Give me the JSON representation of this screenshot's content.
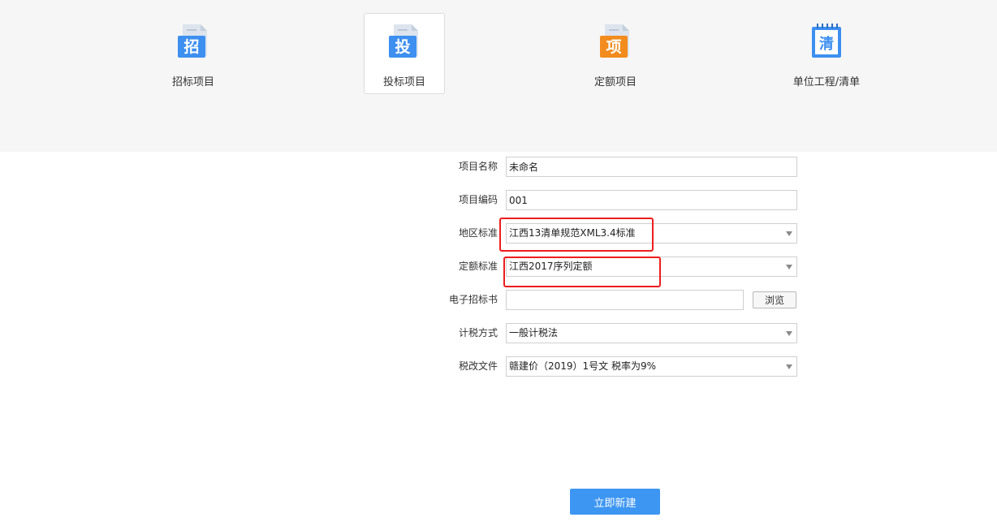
{
  "project_types": [
    {
      "label": "招标项目",
      "icon_char": "招",
      "icon": "bid-invitation-icon",
      "color": "#3d8ff0",
      "active": false
    },
    {
      "label": "投标项目",
      "icon_char": "投",
      "icon": "bid-submission-icon",
      "color": "#3d8ff0",
      "active": true
    },
    {
      "label": "定额项目",
      "icon_char": "项",
      "icon": "quota-project-icon",
      "color": "#f28c1e",
      "active": false
    },
    {
      "label": "单位工程/清单",
      "icon_char": "清",
      "icon": "unit-list-icon",
      "color": "#3d8ff0",
      "active": false
    }
  ],
  "form": {
    "project_name": {
      "label": "项目名称",
      "value": "未命名"
    },
    "project_code": {
      "label": "项目编码",
      "value": "001"
    },
    "region_standard": {
      "label": "地区标准",
      "value": "江西13清单规范XML3.4标准"
    },
    "quota_standard": {
      "label": "定额标准",
      "value": "江西2017序列定额"
    },
    "electronic_bid": {
      "label": "电子招标书",
      "value": "",
      "browse_label": "浏览"
    },
    "tax_method": {
      "label": "计税方式",
      "value": "一般计税法"
    },
    "tax_reform_file": {
      "label": "税改文件",
      "value": "赣建价（2019）1号文 税率为9%"
    }
  },
  "create_button_label": "立即新建",
  "colors": {
    "accent": "#3d96f2",
    "annotation": "#ee1d1d",
    "active_tile_border": "#dcdcdc",
    "top_band": "#f6f6f6"
  }
}
